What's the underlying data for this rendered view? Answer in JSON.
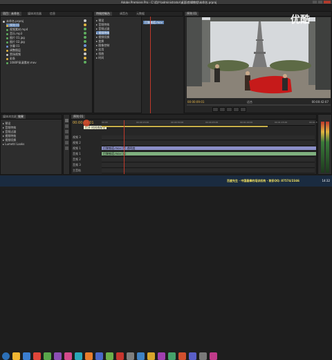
{
  "window": {
    "title": "Adobe Premiere Pro - C:\\用户\\administrator\\桌面\\剪辑教程\\未命名.prproj"
  },
  "project_panel": {
    "tabs": [
      "项目：未命名",
      "媒体浏览器",
      "信息"
    ],
    "items": [
      {
        "label": "未命名.prproj",
        "color": "#c8c8c8"
      },
      {
        "label": "序列 01",
        "color": "#e0b440"
      },
      {
        "label": "视频素材.mp4",
        "color": "#5fae5f"
      },
      {
        "label": "音乐.mp3",
        "color": "#5fae5f"
      },
      {
        "label": "图片 01.jpg",
        "color": "#5fae5f"
      },
      {
        "label": "图片 02.jpg",
        "color": "#5fae5f"
      },
      {
        "label": "字幕 01",
        "color": "#6b8fd6"
      },
      {
        "label": "调整图层",
        "color": "#e0b440"
      },
      {
        "label": "黑场视频",
        "color": "#cccccc"
      },
      {
        "label": "彩条",
        "color": "#e0b440"
      },
      {
        "label": "1080P高清素材.mov",
        "color": "#5fae5f"
      }
    ]
  },
  "effects_panel": {
    "tabs": [
      "特效控制台",
      "调音台",
      "元数据"
    ],
    "items": [
      "▸ 预设",
      "▸ 音频特效",
      "▸ 音频过渡",
      "▸ 视频特效",
      "▸ 视频切换",
      "▸ 变换",
      "▸ 图像控制",
      "▸ 实用",
      "▸ 扭曲",
      "▸ 时间"
    ]
  },
  "source_panel": {
    "tabs": [
      "序列 01"
    ],
    "clip_label": "巴黎铁塔.mov"
  },
  "program_monitor": {
    "timecode_current": "00:00:09:01",
    "timecode_total": "00:00:42:07",
    "fit_label": "适合"
  },
  "media_browser": {
    "tabs": [
      "媒体浏览器",
      "效果"
    ],
    "items": [
      "▸ 预设",
      "▸ 音频特效",
      "▸ 音频过渡",
      "▸ 视频特效",
      "▸ 视频切换",
      "▸ Lumetri Looks"
    ]
  },
  "timeline": {
    "tabs": [
      "序列 01"
    ],
    "timecode": "00:00:09:01",
    "marker_label": "打开 时间线标记",
    "ruler_labels": [
      "00:00",
      "00:00:15:00",
      "00:00:30:00",
      "00:00:45:00",
      "00:01:00:00",
      "00:01:15:00",
      "00:01:30:00"
    ],
    "tracks": [
      {
        "name": "视频 3"
      },
      {
        "name": "视频 2"
      },
      {
        "name": "视频 1"
      },
      {
        "name": "音频 1"
      },
      {
        "name": "音频 2"
      },
      {
        "name": "音频 3"
      },
      {
        "name": "主音轨"
      }
    ],
    "clips": [
      {
        "label": "巴黎铁塔.mov [V] 透明度"
      },
      {
        "label": "巴黎铁塔.mov [A]"
      }
    ]
  },
  "watermark": "优酷",
  "taskbar": {
    "status_text": "百度先生 · 中国最棒的培训机构 · 联系QQ: 87574/2346",
    "time": "14:32"
  }
}
